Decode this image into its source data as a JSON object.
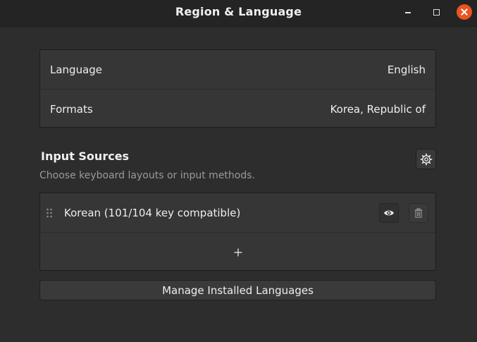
{
  "window": {
    "title": "Region & Language"
  },
  "language_panel": {
    "rows": [
      {
        "label": "Language",
        "value": "English"
      },
      {
        "label": "Formats",
        "value": "Korea, Republic of"
      }
    ]
  },
  "input_sources": {
    "title": "Input Sources",
    "subtitle": "Choose keyboard layouts or input methods.",
    "items": [
      {
        "label": "Korean (101/104 key compatible)"
      }
    ],
    "add_glyph": "+"
  },
  "manage_button": {
    "label": "Manage Installed Languages"
  },
  "icons": {
    "minimize": "minimize-icon",
    "maximize": "maximize-icon",
    "close": "close-icon",
    "options": "gear-icon",
    "drag": "drag-handle-icon",
    "preview": "eye-icon",
    "remove": "trash-icon",
    "add": "plus-icon"
  },
  "colors": {
    "accent_close": "#e95420",
    "background": "#2d2d2d",
    "titlebar": "#242424",
    "panel": "#363636",
    "muted_text": "#9a9a9a"
  }
}
